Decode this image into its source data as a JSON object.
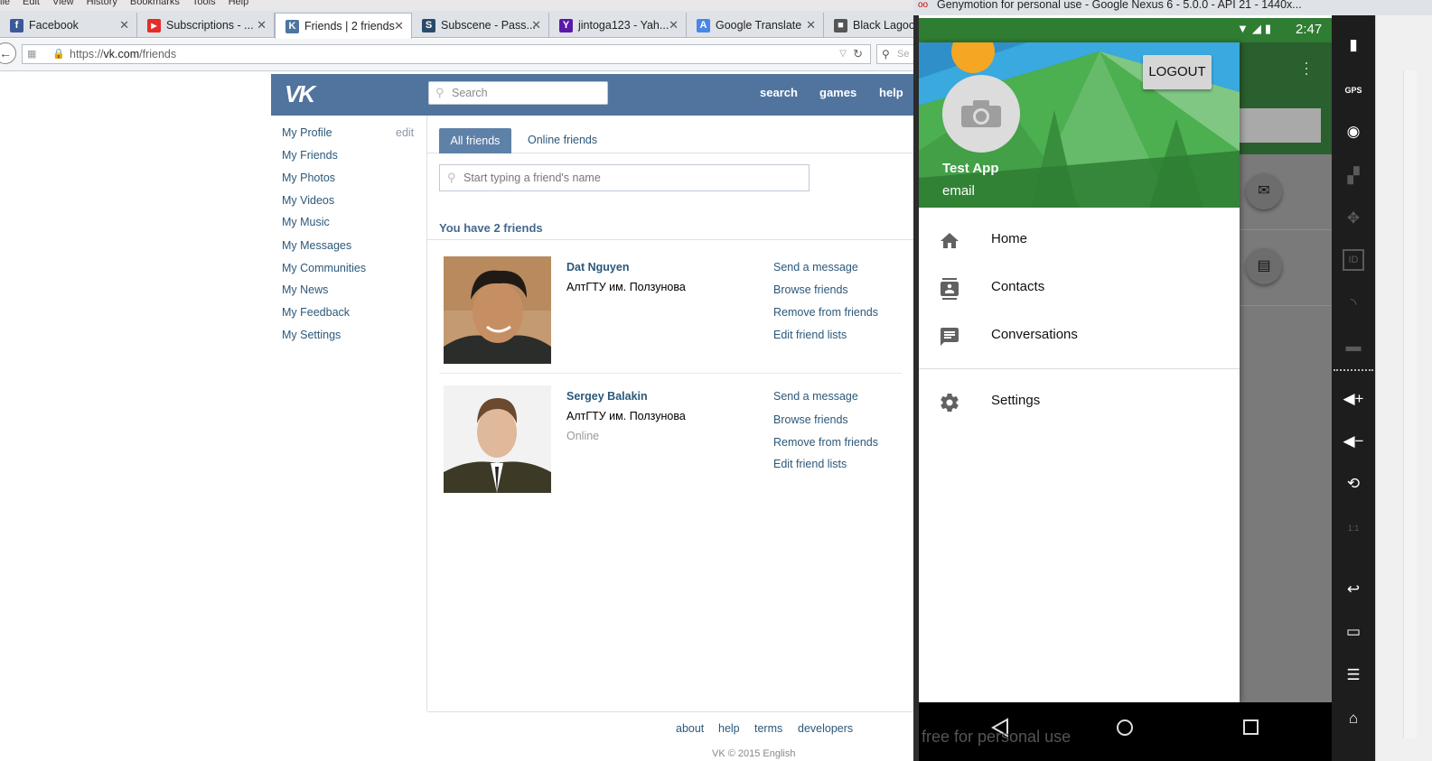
{
  "browser": {
    "menu": [
      "ile",
      "Edit",
      "View",
      "History",
      "Bookmarks",
      "Tools",
      "Help"
    ],
    "tabs": [
      {
        "label": "Facebook",
        "icon": "facebook-icon",
        "color": "#3b5998",
        "glyph": "f"
      },
      {
        "label": "Subscriptions - ...",
        "icon": "youtube-icon",
        "color": "#e52d27",
        "glyph": "▶"
      },
      {
        "label": "Friends | 2 friends",
        "icon": "vk-icon",
        "color": "#4c75a3",
        "glyph": "K"
      },
      {
        "label": "Subscene - Pass...",
        "icon": "subscene-icon",
        "color": "#2a4a6a",
        "glyph": "S"
      },
      {
        "label": "jintoga123 - Yah...",
        "icon": "yahoo-icon",
        "color": "#5b19a8",
        "glyph": "Y"
      },
      {
        "label": "Google Translate",
        "icon": "translate-icon",
        "color": "#4a86e8",
        "glyph": "A"
      },
      {
        "label": "Black Lagoon",
        "icon": "page-icon",
        "color": "#555555",
        "glyph": "■"
      }
    ],
    "url_prefix": "https://",
    "url_host": "vk.com",
    "url_path": "/friends",
    "search_placeholder": "Se"
  },
  "vk": {
    "header_links": {
      "search": "search",
      "games": "games",
      "help": "help"
    },
    "search_placeholder": "Search",
    "left_menu": [
      "My Profile",
      "My Friends",
      "My Photos",
      "My Videos",
      "My Music",
      "My Messages",
      "My Communities",
      "My News",
      "My Feedback",
      "My Settings"
    ],
    "edit_label": "edit",
    "tabs": {
      "all": "All friends",
      "online": "Online friends"
    },
    "friend_search_placeholder": "Start typing a friend's name",
    "friends_count": "You have 2 friends",
    "friends": [
      {
        "name": "Dat Nguyen",
        "university": "АлтГТУ им. Ползунова",
        "status": ""
      },
      {
        "name": "Sergey Balakin",
        "university": "АлтГТУ им. Ползунова",
        "status": "Online"
      }
    ],
    "actions": [
      "Send a message",
      "Browse friends",
      "Remove from friends",
      "Edit friend lists"
    ],
    "footer": [
      "about",
      "help",
      "terms",
      "developers"
    ],
    "copyright": "VK © 2015   English"
  },
  "genymotion": {
    "title": "Genymotion for personal use - Google Nexus 6 - 5.0.0 - API 21 - 1440x...",
    "status_time": "2:47",
    "watermark": "free for personal use",
    "drawer": {
      "logout": "LOGOUT",
      "app_name": "Test App",
      "email": "email",
      "items": [
        {
          "label": "Home",
          "icon": "home-icon"
        },
        {
          "label": "Contacts",
          "icon": "contacts-icon"
        },
        {
          "label": "Conversations",
          "icon": "conversations-icon"
        }
      ],
      "settings": {
        "label": "Settings",
        "icon": "settings-icon"
      }
    },
    "side_panel": {
      "gps": "GPS",
      "id": "ID",
      "scale": "1:1"
    }
  },
  "colors": {
    "vk_header": "#50749e",
    "vk_link": "#2b587a",
    "android_primary": "#2f7d32",
    "drawer_header_green": "#3f9a44"
  }
}
